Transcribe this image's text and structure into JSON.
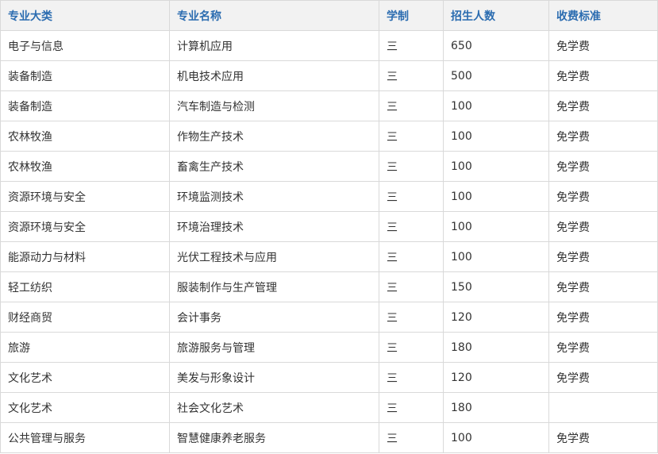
{
  "table": {
    "headers": [
      "专业大类",
      "专业名称",
      "学制",
      "招生人数",
      "收费标准"
    ],
    "rows": [
      [
        "电子与信息",
        "计算机应用",
        "三",
        "650",
        "免学费"
      ],
      [
        "装备制造",
        "机电技术应用",
        "三",
        "500",
        "免学费"
      ],
      [
        "装备制造",
        "汽车制造与检测",
        "三",
        "100",
        "免学费"
      ],
      [
        "农林牧渔",
        "作物生产技术",
        "三",
        "100",
        "免学费"
      ],
      [
        "农林牧渔",
        "畜禽生产技术",
        "三",
        "100",
        "免学费"
      ],
      [
        "资源环境与安全",
        "环境监测技术",
        "三",
        "100",
        "免学费"
      ],
      [
        "资源环境与安全",
        "环境治理技术",
        "三",
        "100",
        "免学费"
      ],
      [
        "能源动力与材料",
        "光伏工程技术与应用",
        "三",
        "100",
        "免学费"
      ],
      [
        "轻工纺织",
        "服装制作与生产管理",
        "三",
        "150",
        "免学费"
      ],
      [
        "财经商贸",
        "会计事务",
        "三",
        "120",
        "免学费"
      ],
      [
        "旅游",
        "旅游服务与管理",
        "三",
        "180",
        "免学费"
      ],
      [
        "文化艺术",
        "美发与形象设计",
        "三",
        "120",
        "免学费"
      ],
      [
        "文化艺术",
        "社会文化艺术",
        "三",
        "180",
        ""
      ],
      [
        "公共管理与服务",
        "智慧健康养老服务",
        "三",
        "100",
        "免学费"
      ]
    ]
  },
  "colors": {
    "header_text": "#2b6cb0",
    "header_bg": "#f2f2f2",
    "border": "#d9d9d9",
    "body_text": "#333333"
  }
}
